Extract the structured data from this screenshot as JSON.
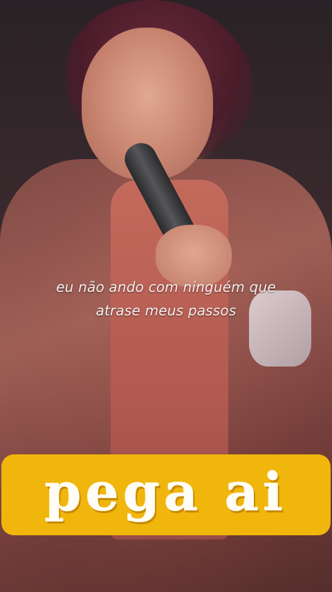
{
  "video": {
    "subtitle_lines": [
      "eu não ando com ninguém que",
      "atrase meus passos"
    ],
    "banner_text": "pega ai"
  },
  "colors": {
    "banner_background": "#f0b60c",
    "banner_text": "#fffdf5",
    "subtitle_text": "#f4eeee"
  }
}
